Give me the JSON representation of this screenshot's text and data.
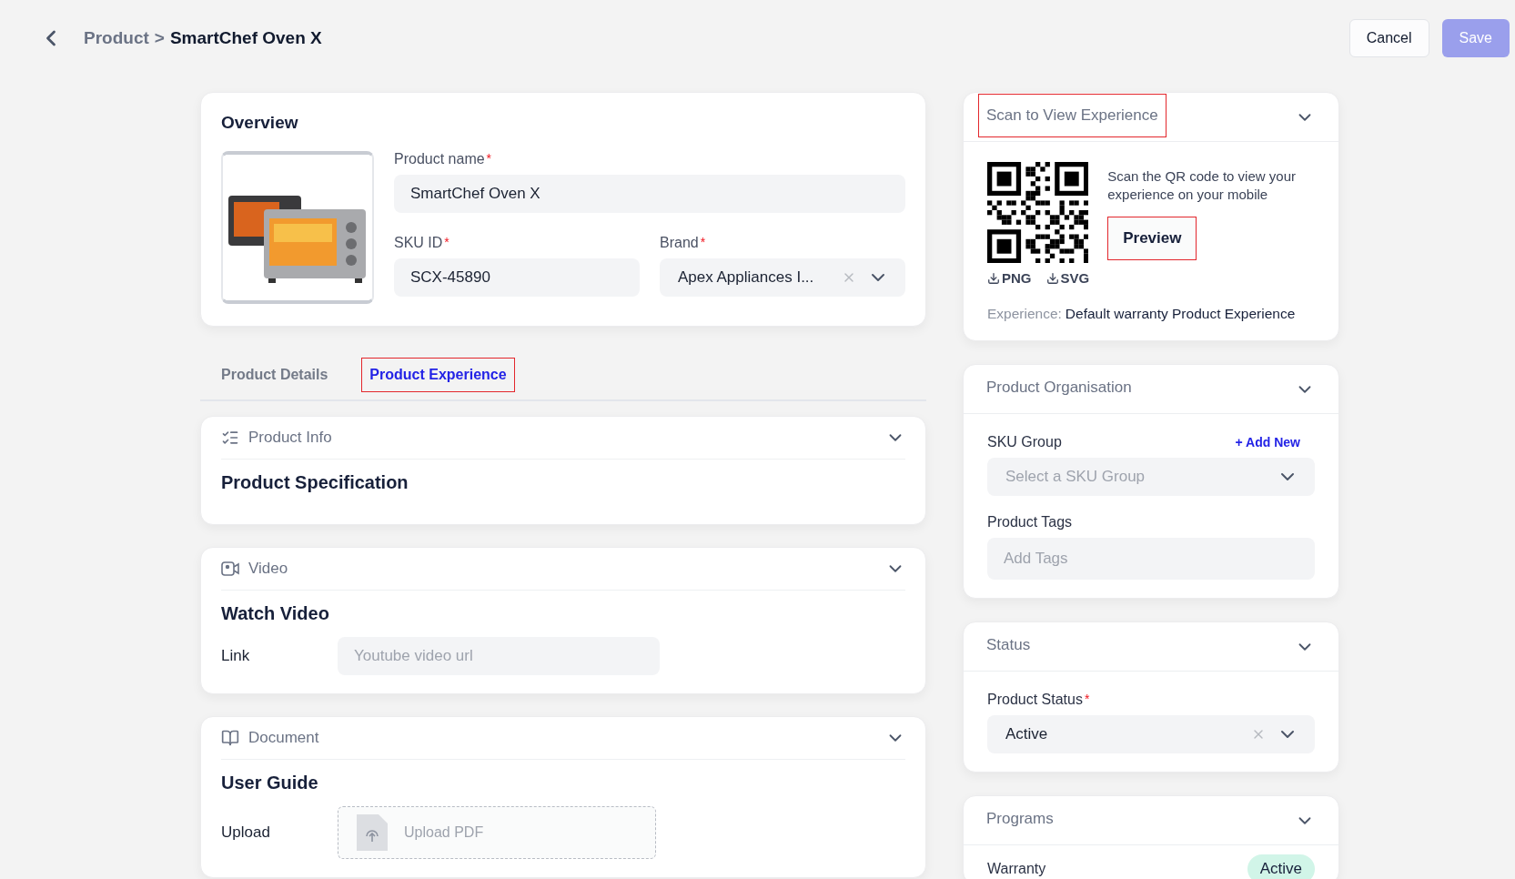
{
  "header": {
    "breadcrumb_parent": "Product",
    "separator": ">",
    "title": "SmartChef Oven X",
    "buttons": [
      {
        "label": "Cancel",
        "kind": "secondary",
        "disabled": false
      },
      {
        "label": "Save",
        "kind": "primary",
        "disabled": true
      }
    ]
  },
  "overview": {
    "title": "Overview",
    "fields": [
      {
        "kind": "text",
        "label": "Product name",
        "mark": "*",
        "value": "SmartChef Oven X"
      },
      {
        "kind": "text",
        "label": "SKU ID",
        "mark": "*",
        "value": "SCX-45890"
      },
      {
        "kind": "select",
        "label": "Brand",
        "mark": "*",
        "value": "Apex Appliances I...",
        "clearable": true
      }
    ]
  },
  "tabs": [
    {
      "label": "Product Details",
      "selected": false,
      "highlighted": false
    },
    {
      "label": "Product Experience",
      "selected": true,
      "highlighted": true
    }
  ],
  "sections": [
    {
      "kind": "info",
      "title": "Product Info",
      "heading": "Product Specification"
    },
    {
      "kind": "video",
      "title": "Video",
      "heading": "Watch Video",
      "row": {
        "label": "Link",
        "placeholder": "Youtube video url"
      }
    },
    {
      "kind": "document",
      "title": "Document",
      "heading": "User Guide",
      "row": {
        "label": "Upload",
        "placeholder": "Upload PDF"
      }
    }
  ],
  "scan": {
    "title": "Scan to View Experience",
    "highlighted": true,
    "instructions": "Scan the QR code to view your experience on your mobile",
    "preview": {
      "label": "Preview",
      "highlighted": true
    },
    "downloads": [
      "PNG",
      "SVG"
    ],
    "experience_label": "Experience:",
    "experience_value": "Default warranty Product Experience"
  },
  "organisation": {
    "title": "Product Organisation",
    "sku_group": {
      "label": "SKU Group",
      "add_new": "+ Add New",
      "placeholder": "Select a SKU Group"
    },
    "tags": {
      "label": "Product Tags",
      "placeholder": "Add Tags"
    }
  },
  "status": {
    "title": "Status",
    "field": {
      "label": "Product Status",
      "mark": "*",
      "value": "Active",
      "clearable": true
    }
  },
  "programs": {
    "title": "Programs",
    "items": [
      {
        "name": "Warranty",
        "status": "Active",
        "color": "#d1f5e8"
      }
    ]
  }
}
